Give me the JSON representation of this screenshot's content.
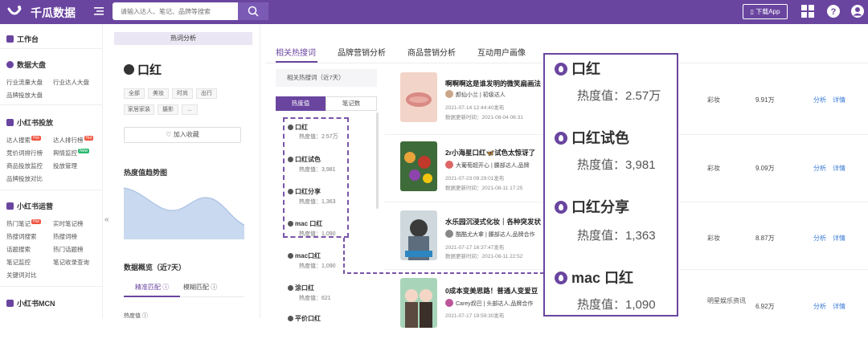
{
  "topbar": {
    "brand": "千瓜数据",
    "search_placeholder": "请输入达人、笔记、品牌等搜索",
    "download_label": "下载App"
  },
  "sidebar": {
    "workbench": "工作台",
    "sections": [
      {
        "title": "数据大盘",
        "items": [
          "行业流量大盘",
          "行业达人大盘",
          "品牌投放大盘"
        ]
      },
      {
        "title": "小红书投放",
        "items": [
          "达人搜索",
          "达人排行榜",
          "竞价词排行榜",
          "舆情监控",
          "商品投放监控",
          "投放管理",
          "品牌投放对比"
        ]
      },
      {
        "title": "小红书运营",
        "items": [
          "热门笔记",
          "实时笔记榜",
          "热搜词搜索",
          "热搜词榜",
          "话题搜索",
          "热门话题榜",
          "笔记监控",
          "笔记收录查询",
          "关键词对比"
        ]
      },
      {
        "title": "小红书MCN",
        "items": []
      }
    ],
    "badge_hot": "Hot",
    "badge_new": "New"
  },
  "left_panel": {
    "header": "热词分析",
    "keyword": "口红",
    "chips": [
      "全部",
      "美妆",
      "时尚",
      "出行",
      "家居家装",
      "摄影",
      "..."
    ],
    "favorite_label": "加入收藏",
    "trend_title": "热度值趋势图",
    "overview_title": "数据概览（近7天）",
    "match_exact": "精准匹配",
    "match_fuzzy": "模糊匹配",
    "heat_label": "热度值"
  },
  "main": {
    "tabs": [
      "相关热搜词",
      "品牌营销分析",
      "商品营销分析",
      "互动用户画像"
    ],
    "related_label": "相关热搜词（近7天）",
    "subtabs": [
      "热度值",
      "笔记数"
    ],
    "related_words": [
      {
        "name": "口红",
        "value": "热度值：2.57万"
      },
      {
        "name": "口红试色",
        "value": "热度值：3,981"
      },
      {
        "name": "口红分享",
        "value": "热度值：1,363"
      },
      {
        "name": "mac 口红",
        "value": "热度值：1,090"
      },
      {
        "name": "mac口红",
        "value": "热度值：1,090"
      },
      {
        "name": "涂口红",
        "value": "热度值：621"
      },
      {
        "name": "平价口红",
        "value": ""
      }
    ]
  },
  "notes": [
    {
      "title": "啊啊啊这是谁发明的微笑扁画法",
      "author": "颜仙小兰",
      "level": "初级达人",
      "published": "2021-07-14 12:44:40发布",
      "updated": "数据更新时间：2021-08-04 06:31",
      "category": "彩妆",
      "fans": "9.91万",
      "analyze": "分析",
      "detail": "详情"
    },
    {
      "title": "2r小海星口红🦋试色太惊讶了",
      "author": "大葡萄超开心",
      "level": "腰部达人,品牌",
      "published": "2021-07-23 09:29:01发布",
      "updated": "数据更新时间：2021-08-11 17:25",
      "category": "彩妆",
      "fans": "9.09万",
      "analyze": "分析",
      "detail": "详情"
    },
    {
      "title": "水乐园沉浸式化妆｜各种突发状",
      "author": "酷酷尤大拿",
      "level": "腰部达人,品牌合作",
      "published": "2021-07-17 16:37:47发布",
      "updated": "数据更新时间：2021-08-11 22:52",
      "category": "彩妆",
      "fans": "8.87万",
      "analyze": "分析",
      "detail": "详情"
    },
    {
      "title": "0成本变美思路！普通人变爱豆",
      "author": "Carey叔巴",
      "level": "头部达人,品牌合作",
      "published": "2021-07-17 19:59:30发布",
      "updated": "",
      "category": "明星娱乐资讯",
      "fans": "6.92万",
      "analyze": "分析",
      "detail": "详情"
    }
  ],
  "overlay": [
    {
      "name": "口红",
      "value": "热度值：2.57万"
    },
    {
      "name": "口红试色",
      "value": "热度值：3,981"
    },
    {
      "name": "口红分享",
      "value": "热度值：1,363"
    },
    {
      "name": "mac 口红",
      "value": "热度值：1,090"
    }
  ],
  "colors": {
    "brand": "#6a45a0",
    "link": "#3a7bd5",
    "hot": "#f0523e",
    "new": "#2cb970"
  }
}
